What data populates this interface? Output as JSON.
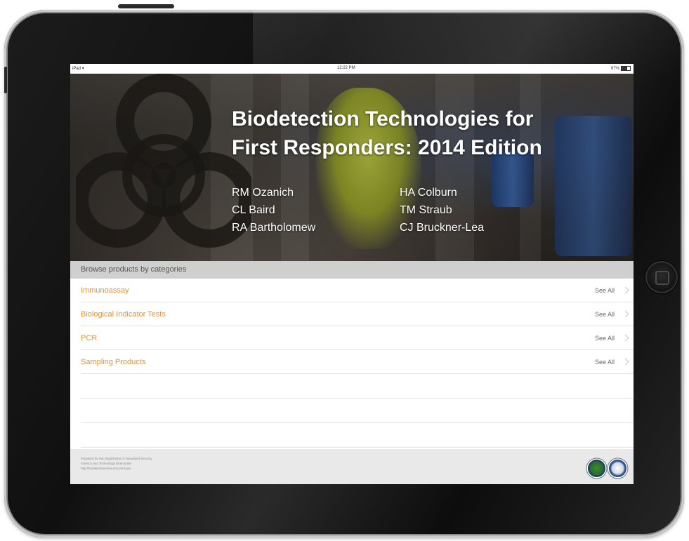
{
  "status_bar": {
    "carrier": "iPad",
    "time": "12:22 PM",
    "battery": "67%",
    "battery_level": 0.67
  },
  "hero": {
    "title_line1": "Biodetection Technologies for",
    "title_line2": "First Responders: 2014 Edition",
    "authors_left": [
      "RM Ozanich",
      "CL Baird",
      "RA Bartholomew"
    ],
    "authors_right": [
      "HA Colburn",
      "TM Straub",
      "CJ Bruckner-Lea"
    ]
  },
  "categories": {
    "header": "Browse products by categories",
    "items": [
      {
        "label": "Immunoassay",
        "action": "See All"
      },
      {
        "label": "Biological Indicator Tests",
        "action": "See All"
      },
      {
        "label": "PCR",
        "action": "See All"
      },
      {
        "label": "Sampling Products",
        "action": "See All"
      }
    ]
  },
  "footer": {
    "line1": "Prepared for the Department of Homeland Security",
    "line2": "Science and Technology Directorate",
    "line3": "http://biodetectionresource.pnnl.gov"
  },
  "colors": {
    "accent": "#e8903a",
    "section_header_bg": "#cfcfcf",
    "footer_bg": "#e9e9e9"
  },
  "icons": [
    "biohazard-icon",
    "chevron-right-icon",
    "battery-icon",
    "wifi-icon"
  ]
}
